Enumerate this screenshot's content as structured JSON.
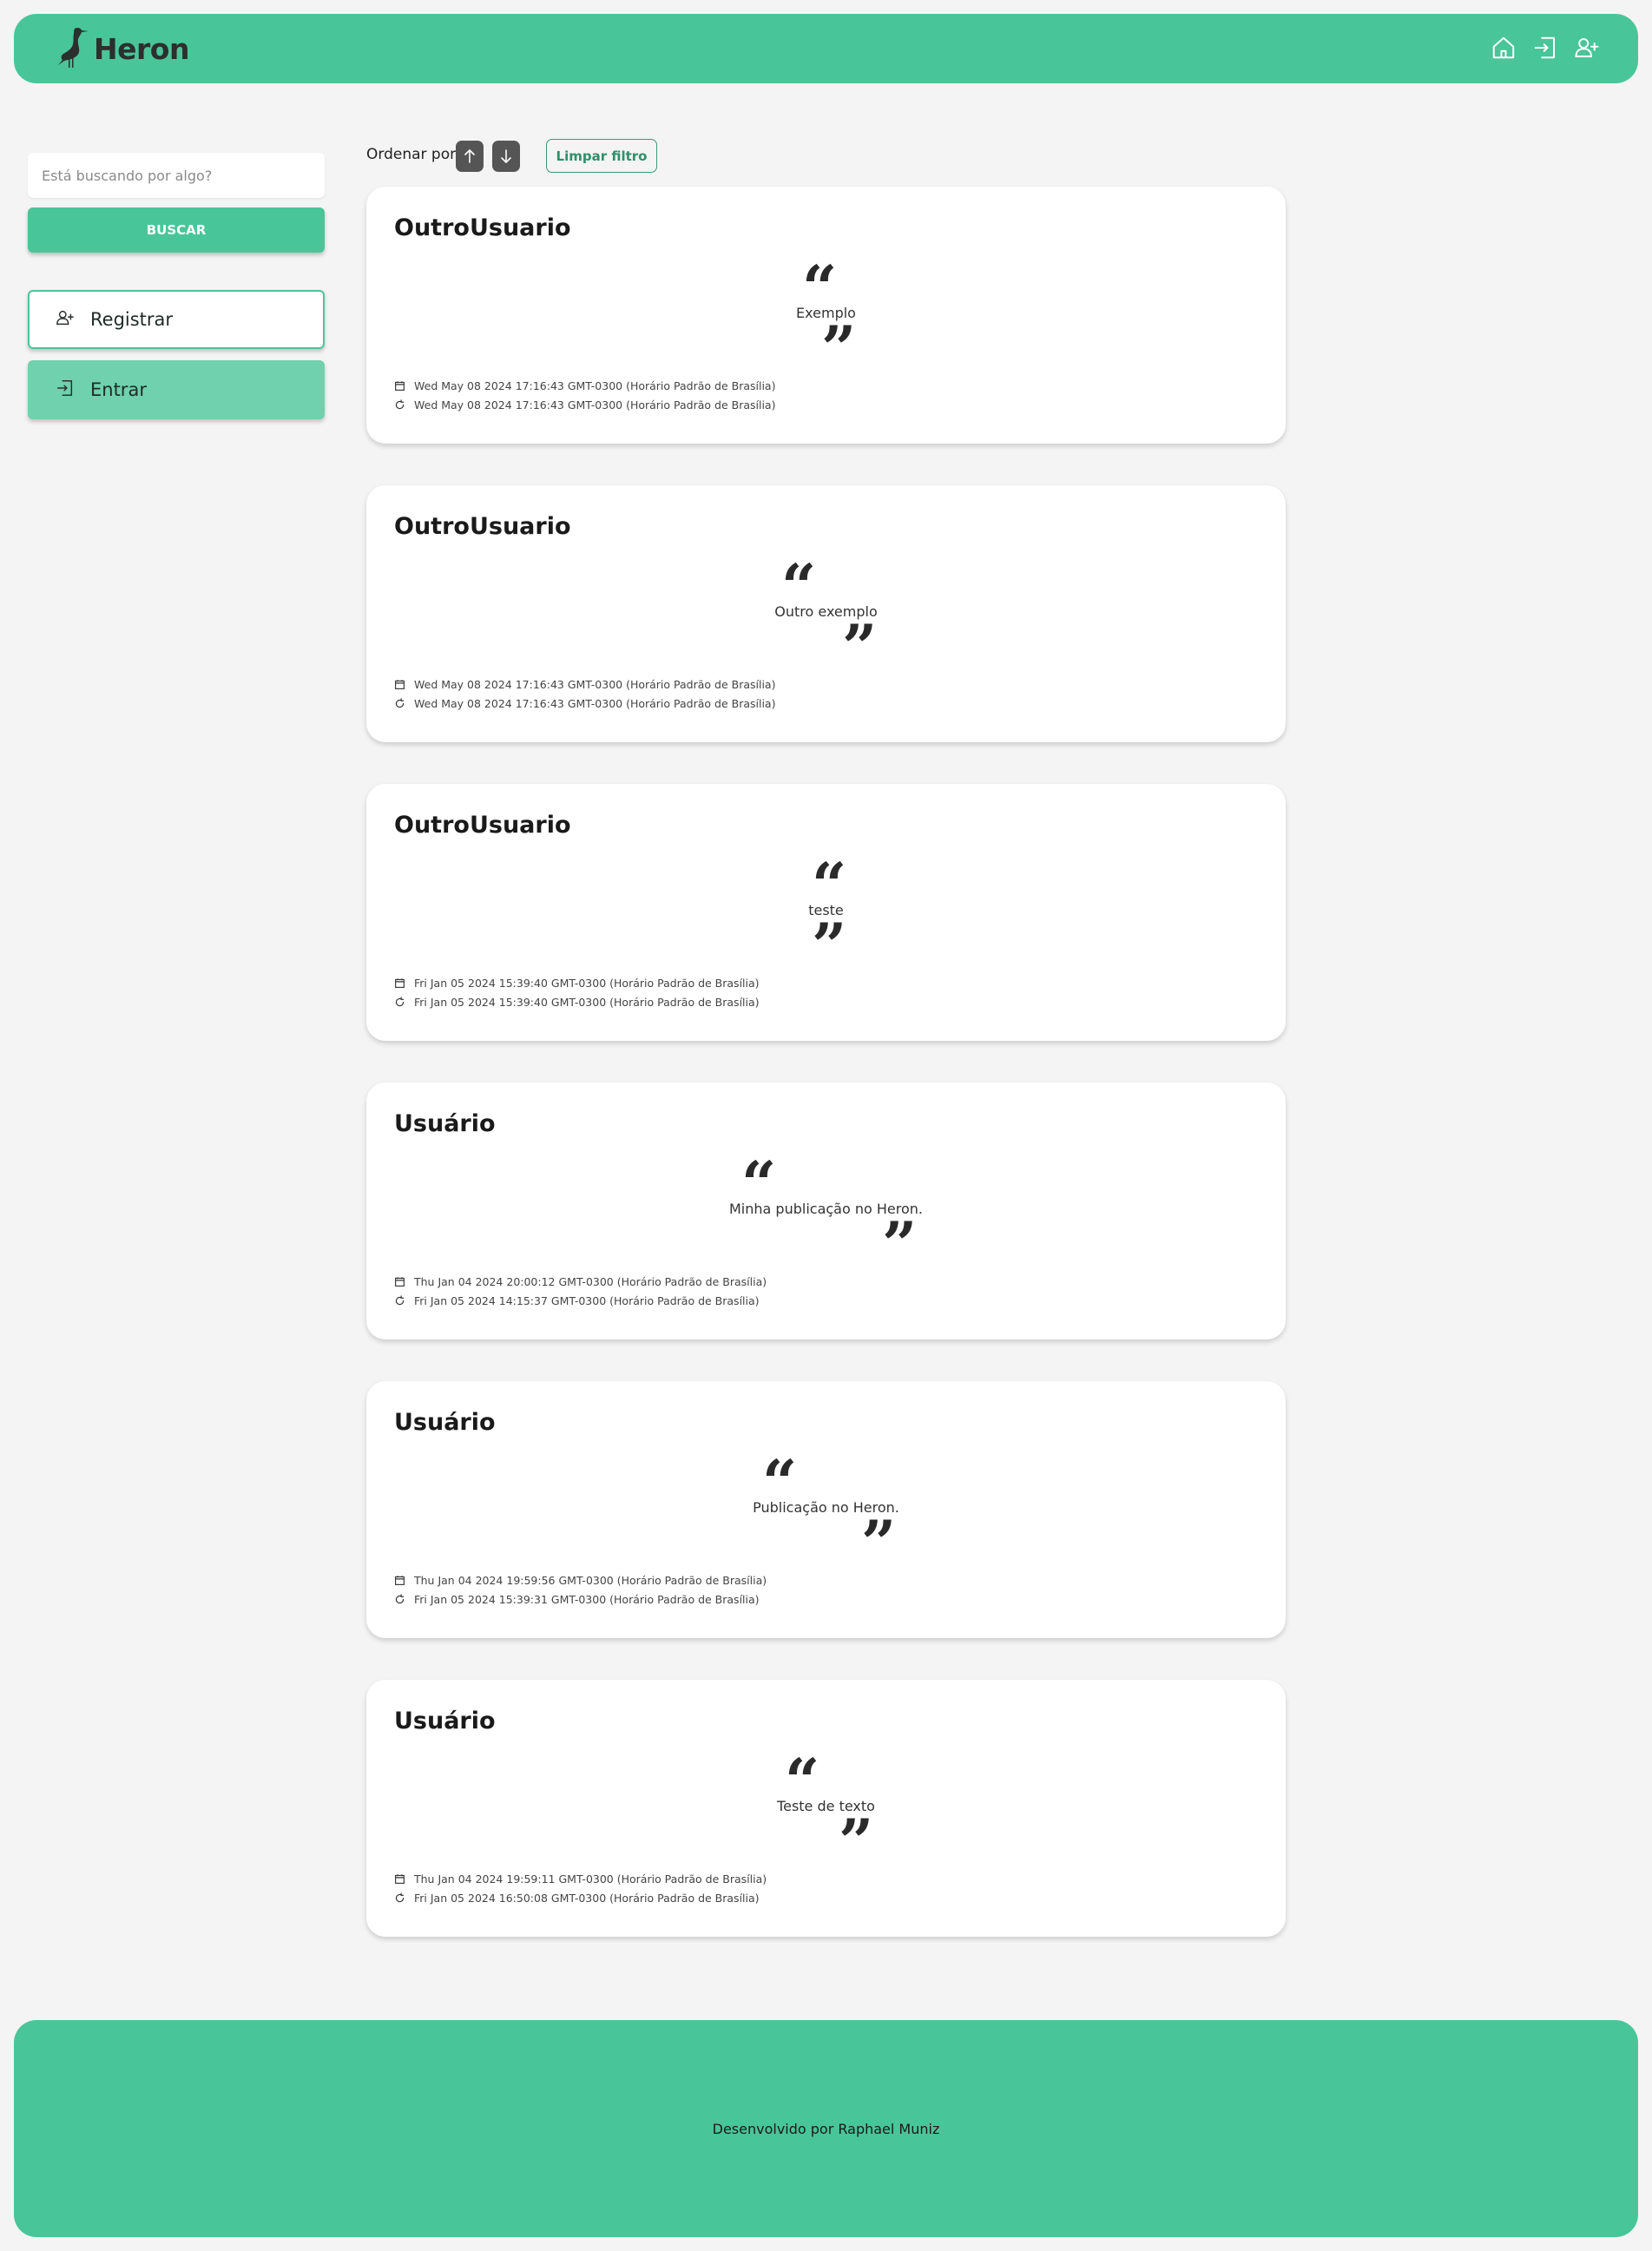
{
  "header": {
    "brand": "Heron",
    "nav_icons": [
      "home-icon",
      "login-icon",
      "user-plus-icon"
    ],
    "color": "#49c59a"
  },
  "sidebar": {
    "search_placeholder": "Está buscando por algo?",
    "search_button": "BUSCAR",
    "register_label": "Registrar",
    "login_label": "Entrar"
  },
  "sort": {
    "label": "Ordenar por:",
    "clear_filter": "Limpar filtro"
  },
  "posts": [
    {
      "author": "OutroUsuario",
      "text": "Exemplo",
      "created": "Wed May 08 2024 17:16:43 GMT-0300 (Horário Padrão de Brasília)",
      "updated": "Wed May 08 2024 17:16:43 GMT-0300 (Horário Padrão de Brasília)"
    },
    {
      "author": "OutroUsuario",
      "text": "Outro exemplo",
      "created": "Wed May 08 2024 17:16:43 GMT-0300 (Horário Padrão de Brasília)",
      "updated": "Wed May 08 2024 17:16:43 GMT-0300 (Horário Padrão de Brasília)"
    },
    {
      "author": "OutroUsuario",
      "text": "teste",
      "created": "Fri Jan 05 2024 15:39:40 GMT-0300 (Horário Padrão de Brasília)",
      "updated": "Fri Jan 05 2024 15:39:40 GMT-0300 (Horário Padrão de Brasília)"
    },
    {
      "author": "Usuário",
      "text": "Minha publicação no Heron.",
      "created": "Thu Jan 04 2024 20:00:12 GMT-0300 (Horário Padrão de Brasília)",
      "updated": "Fri Jan 05 2024 14:15:37 GMT-0300 (Horário Padrão de Brasília)"
    },
    {
      "author": "Usuário",
      "text": "Publicação no Heron.",
      "created": "Thu Jan 04 2024 19:59:56 GMT-0300 (Horário Padrão de Brasília)",
      "updated": "Fri Jan 05 2024 15:39:31 GMT-0300 (Horário Padrão de Brasília)"
    },
    {
      "author": "Usuário",
      "text": "Teste de texto",
      "created": "Thu Jan 04 2024 19:59:11 GMT-0300 (Horário Padrão de Brasília)",
      "updated": "Fri Jan 05 2024 16:50:08 GMT-0300 (Horário Padrão de Brasília)"
    }
  ],
  "quote_marks": {
    "open": "“",
    "close": "”"
  },
  "footer": {
    "text": "Desenvolvido por Raphael Muniz"
  }
}
